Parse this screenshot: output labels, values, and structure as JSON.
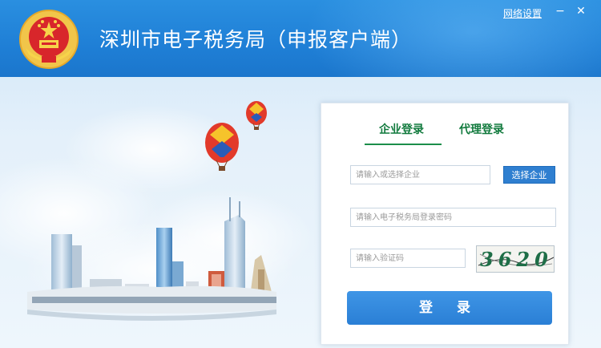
{
  "header": {
    "title": "深圳市电子税务局（申报客户端）",
    "network_settings_label": "网络设置",
    "minimize_glyph": "−",
    "close_glyph": "✕"
  },
  "login": {
    "tabs": [
      {
        "label": "企业登录",
        "active": true
      },
      {
        "label": "代理登录",
        "active": false
      }
    ],
    "company_placeholder": "请输入或选择企业",
    "select_company_label": "选择企业",
    "password_placeholder": "请输入电子税务局登录密码",
    "captcha_placeholder": "请输入验证码",
    "captcha_text": "3620",
    "login_button_label": "登 录"
  },
  "colors": {
    "header_blue": "#1f7fd6",
    "tab_green": "#117a3d",
    "button_blue": "#2f7fd0"
  }
}
